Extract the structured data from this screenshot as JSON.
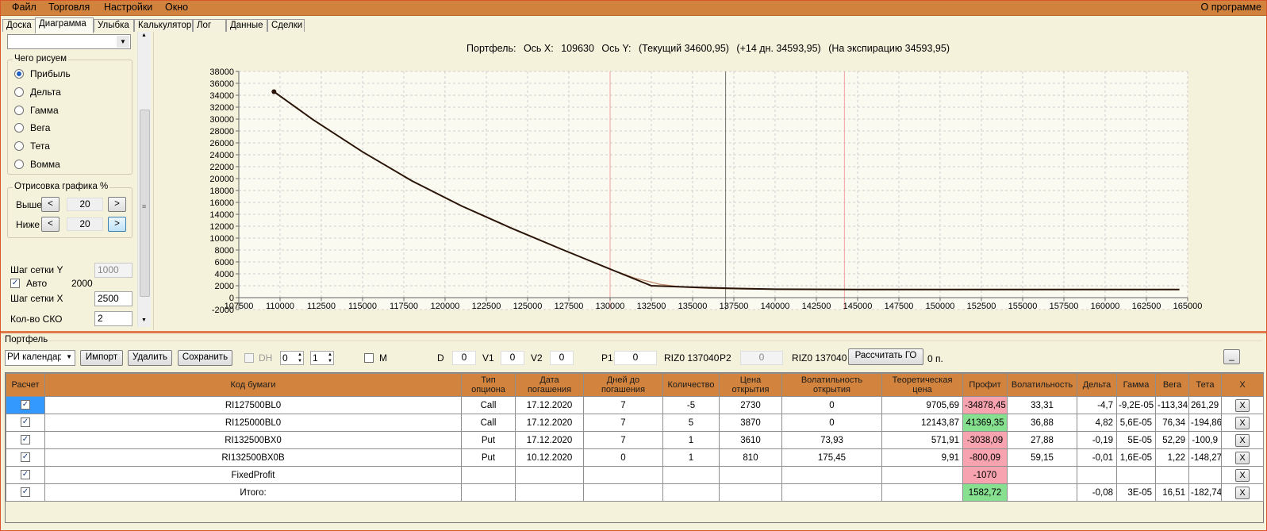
{
  "menu": {
    "items": [
      "Файл",
      "Торговля",
      "Настройки",
      "Окно"
    ],
    "about": "О программе"
  },
  "tabs": [
    "Доска",
    "Диаграмма",
    "Улыбка",
    "Калькулятор",
    "Лог",
    "Данные",
    "Сделки"
  ],
  "active_tab": "Диаграмма",
  "left": {
    "draw_group_title": "Чего рисуем",
    "radio_options": [
      "Прибыль",
      "Дельта",
      "Гамма",
      "Вега",
      "Тета",
      "Вомма"
    ],
    "selected_option": "Прибыль",
    "plot_group_title": "Отрисовка графика %",
    "above_label": "Выше",
    "above_value": "20",
    "below_label": "Ниже",
    "below_value": "20",
    "btn_less": "<",
    "btn_more": ">",
    "grid_y_label": "Шаг сетки Y",
    "grid_y_value": "1000",
    "auto_label": "Авто",
    "auto_value": "2000",
    "grid_x_label": "Шаг сетки X",
    "grid_x_value": "2500",
    "sko_label": "Кол-во СКО",
    "sko_value": "2"
  },
  "chart_title": {
    "portfolio": "Портфель:",
    "axis_x_label": "Ось X:",
    "axis_x_value": "109630",
    "axis_y_label": "Ось Y:",
    "current": "(Текущий 34600,95)",
    "plus14": "(+14 дн. 34593,95)",
    "expiration": "(На экспирацию 34593,95)"
  },
  "chart_data": {
    "type": "line",
    "xlim": [
      107500,
      165000
    ],
    "ylim": [
      -2000,
      38000
    ],
    "x_ticks": [
      107500,
      110000,
      112500,
      115000,
      117500,
      120000,
      122500,
      125000,
      127500,
      130000,
      132500,
      135000,
      137500,
      140000,
      142500,
      145000,
      147500,
      150000,
      152500,
      155000,
      157500,
      160000,
      162500,
      165000
    ],
    "y_ticks": [
      -2000,
      0,
      2000,
      4000,
      6000,
      8000,
      10000,
      12000,
      14000,
      16000,
      18000,
      20000,
      22000,
      24000,
      26000,
      28000,
      30000,
      32000,
      34000,
      36000,
      38000
    ],
    "grid": true,
    "vertical_lines": [
      {
        "x": 130000,
        "color": "#f0a0a0"
      },
      {
        "x": 137000,
        "color": "#707070"
      },
      {
        "x": 144200,
        "color": "#f0a0a0"
      }
    ],
    "marker": {
      "x": 109630,
      "y": 34600
    },
    "series": [
      {
        "color": "#c28a6a",
        "x": [
          109630,
          112000,
          115000,
          118000,
          121000,
          124000,
          127000,
          130000,
          131500,
          133000,
          134500,
          136000,
          138000,
          141000,
          145000,
          150000,
          155000,
          160000,
          164500
        ],
        "y": [
          34600,
          29900,
          24500,
          19600,
          15400,
          11700,
          8200,
          4800,
          3300,
          2250,
          1750,
          1550,
          1450,
          1400,
          1370,
          1360,
          1360,
          1360,
          1360
        ]
      },
      {
        "color": "#2a1408",
        "x": [
          109630,
          112000,
          115000,
          118000,
          121000,
          124000,
          127000,
          130000,
          132500,
          135000,
          137500,
          140000,
          145000,
          150000,
          155000,
          160000,
          164500
        ],
        "y": [
          34600,
          29900,
          24500,
          19600,
          15400,
          11700,
          8200,
          4800,
          2000,
          1750,
          1550,
          1420,
          1360,
          1360,
          1360,
          1360,
          1360
        ]
      }
    ]
  },
  "portfolio": {
    "section_label": "Портфель",
    "combo_value": "РИ календарь",
    "btn_import": "Импорт",
    "btn_delete": "Удалить",
    "btn_save": "Сохранить",
    "dh_label": "DH",
    "dh_spin1": "0",
    "dh_spin2": "1",
    "m_label": "M",
    "d_label": "D",
    "d_value": "0",
    "v1_label": "V1",
    "v1_value": "0",
    "v2_label": "V2",
    "v2_value": "0",
    "p1_label": "P1",
    "p1_value": "0",
    "riz1": "RIZ0 137040",
    "p2_label": "P2",
    "p2_value": "0",
    "riz2": "RIZ0 137040",
    "btn_calc": "Рассчитать ГО",
    "go_value": "0 п.",
    "btn_min": "_"
  },
  "table": {
    "headers": [
      "Расчет",
      "Код бумаги",
      "Тип опциона",
      "Дата погашения",
      "Дней до погашения",
      "Количество",
      "Цена открытия",
      "Волатильность открытия",
      "Теоретическая цена",
      "Профит",
      "Волатильность",
      "Дельта",
      "Гамма",
      "Вега",
      "Тета",
      "X"
    ],
    "rows": [
      {
        "code": "RI127500BL0",
        "type": "Call",
        "date": "17.12.2020",
        "days": "7",
        "qty": "-5",
        "open": "2730",
        "vol_open": "0",
        "theo": "9705,69",
        "profit": "-34878,45",
        "profit_sign": "neg",
        "vol": "33,31",
        "delta": "-4,7",
        "gamma": "-9,2E-05",
        "vega": "-113,34",
        "theta": "261,29"
      },
      {
        "code": "RI125000BL0",
        "type": "Call",
        "date": "17.12.2020",
        "days": "7",
        "qty": "5",
        "open": "3870",
        "vol_open": "0",
        "theo": "12143,87",
        "profit": "41369,35",
        "profit_sign": "pos",
        "vol": "36,88",
        "delta": "4,82",
        "gamma": "5,6E-05",
        "vega": "76,34",
        "theta": "-194,86"
      },
      {
        "code": "RI132500BX0",
        "type": "Put",
        "date": "17.12.2020",
        "days": "7",
        "qty": "1",
        "open": "3610",
        "vol_open": "73,93",
        "theo": "571,91",
        "profit": "-3038,09",
        "profit_sign": "neg",
        "vol": "27,88",
        "delta": "-0,19",
        "gamma": "5E-05",
        "vega": "52,29",
        "theta": "-100,9"
      },
      {
        "code": "RI132500BX0B",
        "type": "Put",
        "date": "10.12.2020",
        "days": "0",
        "qty": "1",
        "open": "810",
        "vol_open": "175,45",
        "theo": "9,91",
        "profit": "-800,09",
        "profit_sign": "neg",
        "vol": "59,15",
        "delta": "-0,01",
        "gamma": "1,6E-05",
        "vega": "1,22",
        "theta": "-148,27"
      },
      {
        "code": "FixedProfit",
        "type": "",
        "date": "",
        "days": "",
        "qty": "",
        "open": "",
        "vol_open": "",
        "theo": "",
        "profit": "-1070",
        "profit_sign": "neg",
        "vol": "",
        "delta": "",
        "gamma": "",
        "vega": "",
        "theta": ""
      },
      {
        "code": "Итого:",
        "type": "",
        "date": "",
        "days": "",
        "qty": "",
        "open": "",
        "vol_open": "",
        "theo": "",
        "profit": "1582,72",
        "profit_sign": "pos",
        "vol": "",
        "delta": "-0,08",
        "gamma": "3E-05",
        "vega": "16,51",
        "theta": "-182,74"
      }
    ],
    "x_label": "X"
  },
  "colors": {
    "menubar": "#d1833e",
    "header": "#d2843e",
    "positive": "#87e08f",
    "negative": "#f7a4b0",
    "selection": "#3399ff"
  }
}
